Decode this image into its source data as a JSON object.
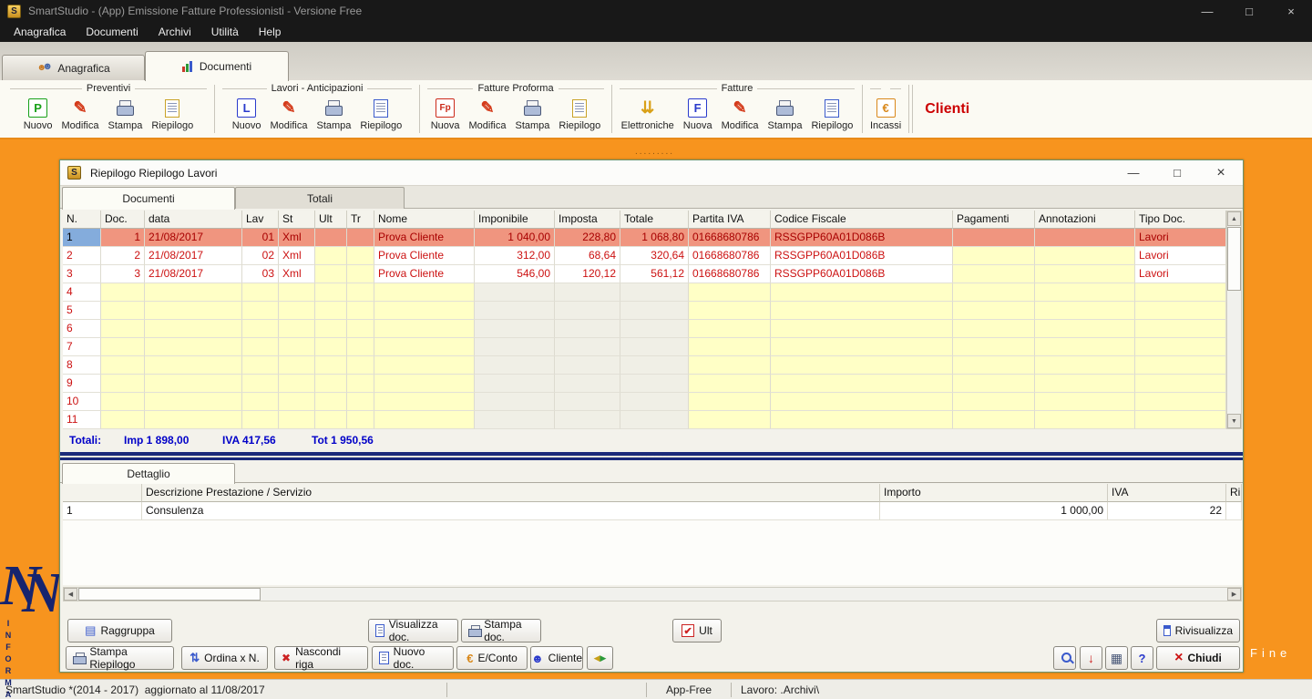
{
  "titlebar": {
    "icon_text": "S",
    "title": "SmartStudio  - (App) Emissione Fatture Professionisti - Versione Free",
    "controls": {
      "minimize": "—",
      "maximize": "□",
      "close": "×"
    }
  },
  "menubar": {
    "items": [
      "Anagrafica",
      "Documenti",
      "Archivi",
      "Utilità",
      "Help"
    ]
  },
  "main_tabs": {
    "anagrafica": "Anagrafica",
    "documenti": "Documenti"
  },
  "toolbar": {
    "groups": [
      {
        "title": "Preventivi",
        "buttons": [
          {
            "label": "Nuovo",
            "icon": "letter",
            "glyph": "P",
            "color": "#18a018",
            "icon_name": "new-preventivo-icon"
          },
          {
            "label": "Modifica",
            "icon": "pencil",
            "glyph": "✎",
            "color": "#d43a1a",
            "icon_name": "edit-icon"
          },
          {
            "label": "Stampa",
            "icon": "printer",
            "icon_name": "print-icon"
          },
          {
            "label": "Riepilogo",
            "icon": "doc",
            "color": "#c9a227",
            "icon_name": "summary-icon"
          }
        ]
      },
      {
        "title": "Lavori - Anticipazioni",
        "buttons": [
          {
            "label": "Nuovo",
            "icon": "letter",
            "glyph": "L",
            "color": "#2a3acc",
            "icon_name": "new-lavoro-icon"
          },
          {
            "label": "Modifica",
            "icon": "pencil",
            "glyph": "✎",
            "color": "#d43a1a",
            "icon_name": "edit-icon"
          },
          {
            "label": "Stampa",
            "icon": "printer",
            "icon_name": "print-icon"
          },
          {
            "label": "Riepilogo",
            "icon": "doc",
            "color": "#3a5acc",
            "icon_name": "summary-icon"
          }
        ]
      },
      {
        "title": "Fatture Proforma",
        "buttons": [
          {
            "label": "Nuova",
            "icon": "letter",
            "glyph": "Fp",
            "color": "#cc2a1a",
            "icon_name": "new-proforma-icon"
          },
          {
            "label": "Modifica",
            "icon": "pencil",
            "glyph": "✎",
            "color": "#d43a1a",
            "icon_name": "edit-icon"
          },
          {
            "label": "Stampa",
            "icon": "printer",
            "icon_name": "print-icon"
          },
          {
            "label": "Riepilogo",
            "icon": "doc",
            "color": "#c9a227",
            "icon_name": "summary-icon"
          }
        ]
      },
      {
        "title": "Fatture",
        "buttons": [
          {
            "label": "Elettroniche",
            "icon": "arrows",
            "glyph": "⇊",
            "color": "#d9a016",
            "icon_name": "electronic-invoice-icon"
          },
          {
            "label": "Nuova",
            "icon": "letter",
            "glyph": "F",
            "color": "#2a3acc",
            "icon_name": "new-fattura-icon"
          },
          {
            "label": "Modifica",
            "icon": "pencil",
            "glyph": "✎",
            "color": "#d43a1a",
            "icon_name": "edit-icon"
          },
          {
            "label": "Stampa",
            "icon": "printer",
            "icon_name": "print-icon"
          },
          {
            "label": "Riepilogo",
            "icon": "doc",
            "color": "#3a5acc",
            "icon_name": "summary-icon"
          }
        ]
      }
    ],
    "incassi": {
      "label": "Incassi",
      "icon": "letter",
      "glyph": "€",
      "color": "#d9881a",
      "icon_name": "cash-icon"
    },
    "clienti_label": "Clienti"
  },
  "child_window": {
    "title": "Riepilogo Riepilogo Lavori",
    "tab_documenti": "Documenti",
    "tab_totali": "Totali",
    "controls": {
      "minimize": "—",
      "maximize": "□",
      "close": "×"
    }
  },
  "doc_table": {
    "columns": [
      "N.",
      "Doc.",
      "data",
      "Lav",
      "St",
      "Ult",
      "Tr",
      "Nome",
      "Imponibile",
      "Imposta",
      "Totale",
      "Partita IVA",
      "Codice Fiscale",
      "Pagamenti",
      "Annotazioni",
      "Tipo Doc."
    ],
    "rows": [
      {
        "selected": true,
        "cells": [
          "1",
          "1",
          "21/08/2017",
          "01",
          "Xml",
          "",
          "",
          "Prova Cliente",
          "1 040,00",
          "228,80",
          "1 068,80",
          "01668680786",
          "RSSGPP60A01D086B",
          "",
          "",
          "Lavori"
        ]
      },
      {
        "cells": [
          "2",
          "2",
          "21/08/2017",
          "02",
          "Xml",
          "",
          "",
          "Prova Cliente",
          "312,00",
          "68,64",
          "320,64",
          "01668680786",
          "RSSGPP60A01D086B",
          "",
          "",
          "Lavori"
        ]
      },
      {
        "cells": [
          "3",
          "3",
          "21/08/2017",
          "03",
          "Xml",
          "",
          "",
          "Prova Cliente",
          "546,00",
          "120,12",
          "561,12",
          "01668680786",
          "RSSGPP60A01D086B",
          "",
          "",
          "Lavori"
        ]
      },
      {
        "cells": [
          "4",
          "",
          "",
          "",
          "",
          "",
          "",
          "",
          "",
          "",
          "",
          "",
          "",
          "",
          "",
          ""
        ]
      },
      {
        "cells": [
          "5",
          "",
          "",
          "",
          "",
          "",
          "",
          "",
          "",
          "",
          "",
          "",
          "",
          "",
          "",
          ""
        ]
      },
      {
        "cells": [
          "6",
          "",
          "",
          "",
          "",
          "",
          "",
          "",
          "",
          "",
          "",
          "",
          "",
          "",
          "",
          ""
        ]
      },
      {
        "cells": [
          "7",
          "",
          "",
          "",
          "",
          "",
          "",
          "",
          "",
          "",
          "",
          "",
          "",
          "",
          "",
          ""
        ]
      },
      {
        "cells": [
          "8",
          "",
          "",
          "",
          "",
          "",
          "",
          "",
          "",
          "",
          "",
          "",
          "",
          "",
          "",
          ""
        ]
      },
      {
        "cells": [
          "9",
          "",
          "",
          "",
          "",
          "",
          "",
          "",
          "",
          "",
          "",
          "",
          "",
          "",
          "",
          ""
        ]
      },
      {
        "cells": [
          "10",
          "",
          "",
          "",
          "",
          "",
          "",
          "",
          "",
          "",
          "",
          "",
          "",
          "",
          "",
          ""
        ]
      },
      {
        "cells": [
          "11",
          "",
          "",
          "",
          "",
          "",
          "",
          "",
          "",
          "",
          "",
          "",
          "",
          "",
          "",
          ""
        ]
      }
    ]
  },
  "totals": {
    "label": "Totali:",
    "imp": "Imp  1 898,00",
    "iva": "IVA  417,56",
    "tot": "Tot  1 950,56"
  },
  "detail": {
    "tab": "Dettaglio",
    "columns": [
      "",
      "Descrizione Prestazione / Servizio",
      "Importo",
      "IVA",
      "Ri"
    ],
    "rows": [
      [
        "1",
        "Consulenza",
        "1 000,00",
        "22",
        ""
      ]
    ]
  },
  "buttons": {
    "raggruppa": "Raggruppa",
    "visualizza": "Visualizza doc.",
    "stampa_doc": "Stampa doc.",
    "ult": "Ult",
    "rivisualizza": "Rivisualizza",
    "stampa_riepilogo": "Stampa Riepilogo",
    "ordina": "Ordina x N.",
    "nascondi": "Nascondi riga",
    "nuovo_doc": "Nuovo doc.",
    "econto": "E/Conto",
    "cliente": "Cliente",
    "chiudi": "Chiudi"
  },
  "statusbar": {
    "left": "SmartStudio *(2014 - 2017)  aggiornato al 11/08/2017",
    "app": "App-Free",
    "lavoro": "Lavoro: .Archivi\\"
  },
  "misc": {
    "dots": ".........",
    "fine": "Fine"
  },
  "logo": {
    "vertical_text": "INFORMA"
  }
}
